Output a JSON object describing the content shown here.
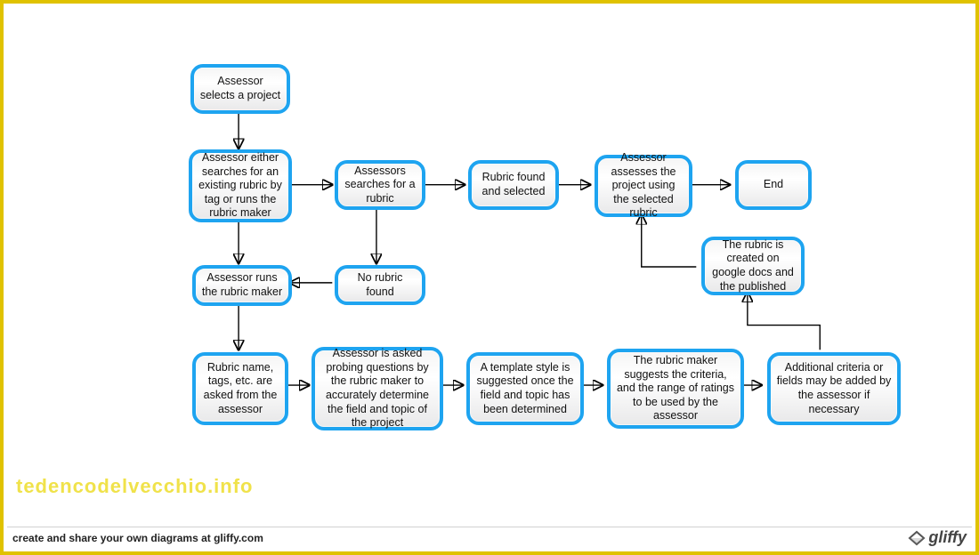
{
  "chart_data": {
    "type": "flowchart",
    "nodes": [
      {
        "id": "n1",
        "text": "Assessor selects a project"
      },
      {
        "id": "n2",
        "text": "Assessor either searches for an existing rubric by tag or runs the rubric maker"
      },
      {
        "id": "n3",
        "text": "Assessors searches for a rubric"
      },
      {
        "id": "n4",
        "text": "Rubric found and selected"
      },
      {
        "id": "n5",
        "text": "Assessor assesses the project using the selected rubric"
      },
      {
        "id": "n6",
        "text": "End"
      },
      {
        "id": "n7",
        "text": "No rubric found"
      },
      {
        "id": "n8",
        "text": "Assessor runs the rubric maker"
      },
      {
        "id": "n9",
        "text": "Rubric name, tags, etc. are asked from the assessor"
      },
      {
        "id": "n10",
        "text": "Assessor is asked probing questions by the rubric maker to accurately determine the field and topic of the project"
      },
      {
        "id": "n11",
        "text": "A template style is suggested once the field and topic has been determined"
      },
      {
        "id": "n12",
        "text": "The rubric maker suggests the criteria, and the range of ratings to be used by the assessor"
      },
      {
        "id": "n13",
        "text": "Additional criteria or fields may be added by the assessor if necessary"
      },
      {
        "id": "n14",
        "text": "The rubric is created on google docs and the published"
      }
    ],
    "edges": [
      [
        "n1",
        "n2"
      ],
      [
        "n2",
        "n3"
      ],
      [
        "n3",
        "n4"
      ],
      [
        "n4",
        "n5"
      ],
      [
        "n5",
        "n6"
      ],
      [
        "n3",
        "n7"
      ],
      [
        "n7",
        "n8"
      ],
      [
        "n2",
        "n8"
      ],
      [
        "n8",
        "n9"
      ],
      [
        "n9",
        "n10"
      ],
      [
        "n10",
        "n11"
      ],
      [
        "n11",
        "n12"
      ],
      [
        "n12",
        "n13"
      ],
      [
        "n13",
        "n14"
      ],
      [
        "n14",
        "n5"
      ]
    ]
  },
  "watermark": "tedencodelvecchio.info",
  "footer": {
    "text": "create and share your own diagrams at gliffy.com",
    "brand": "gliffy"
  }
}
